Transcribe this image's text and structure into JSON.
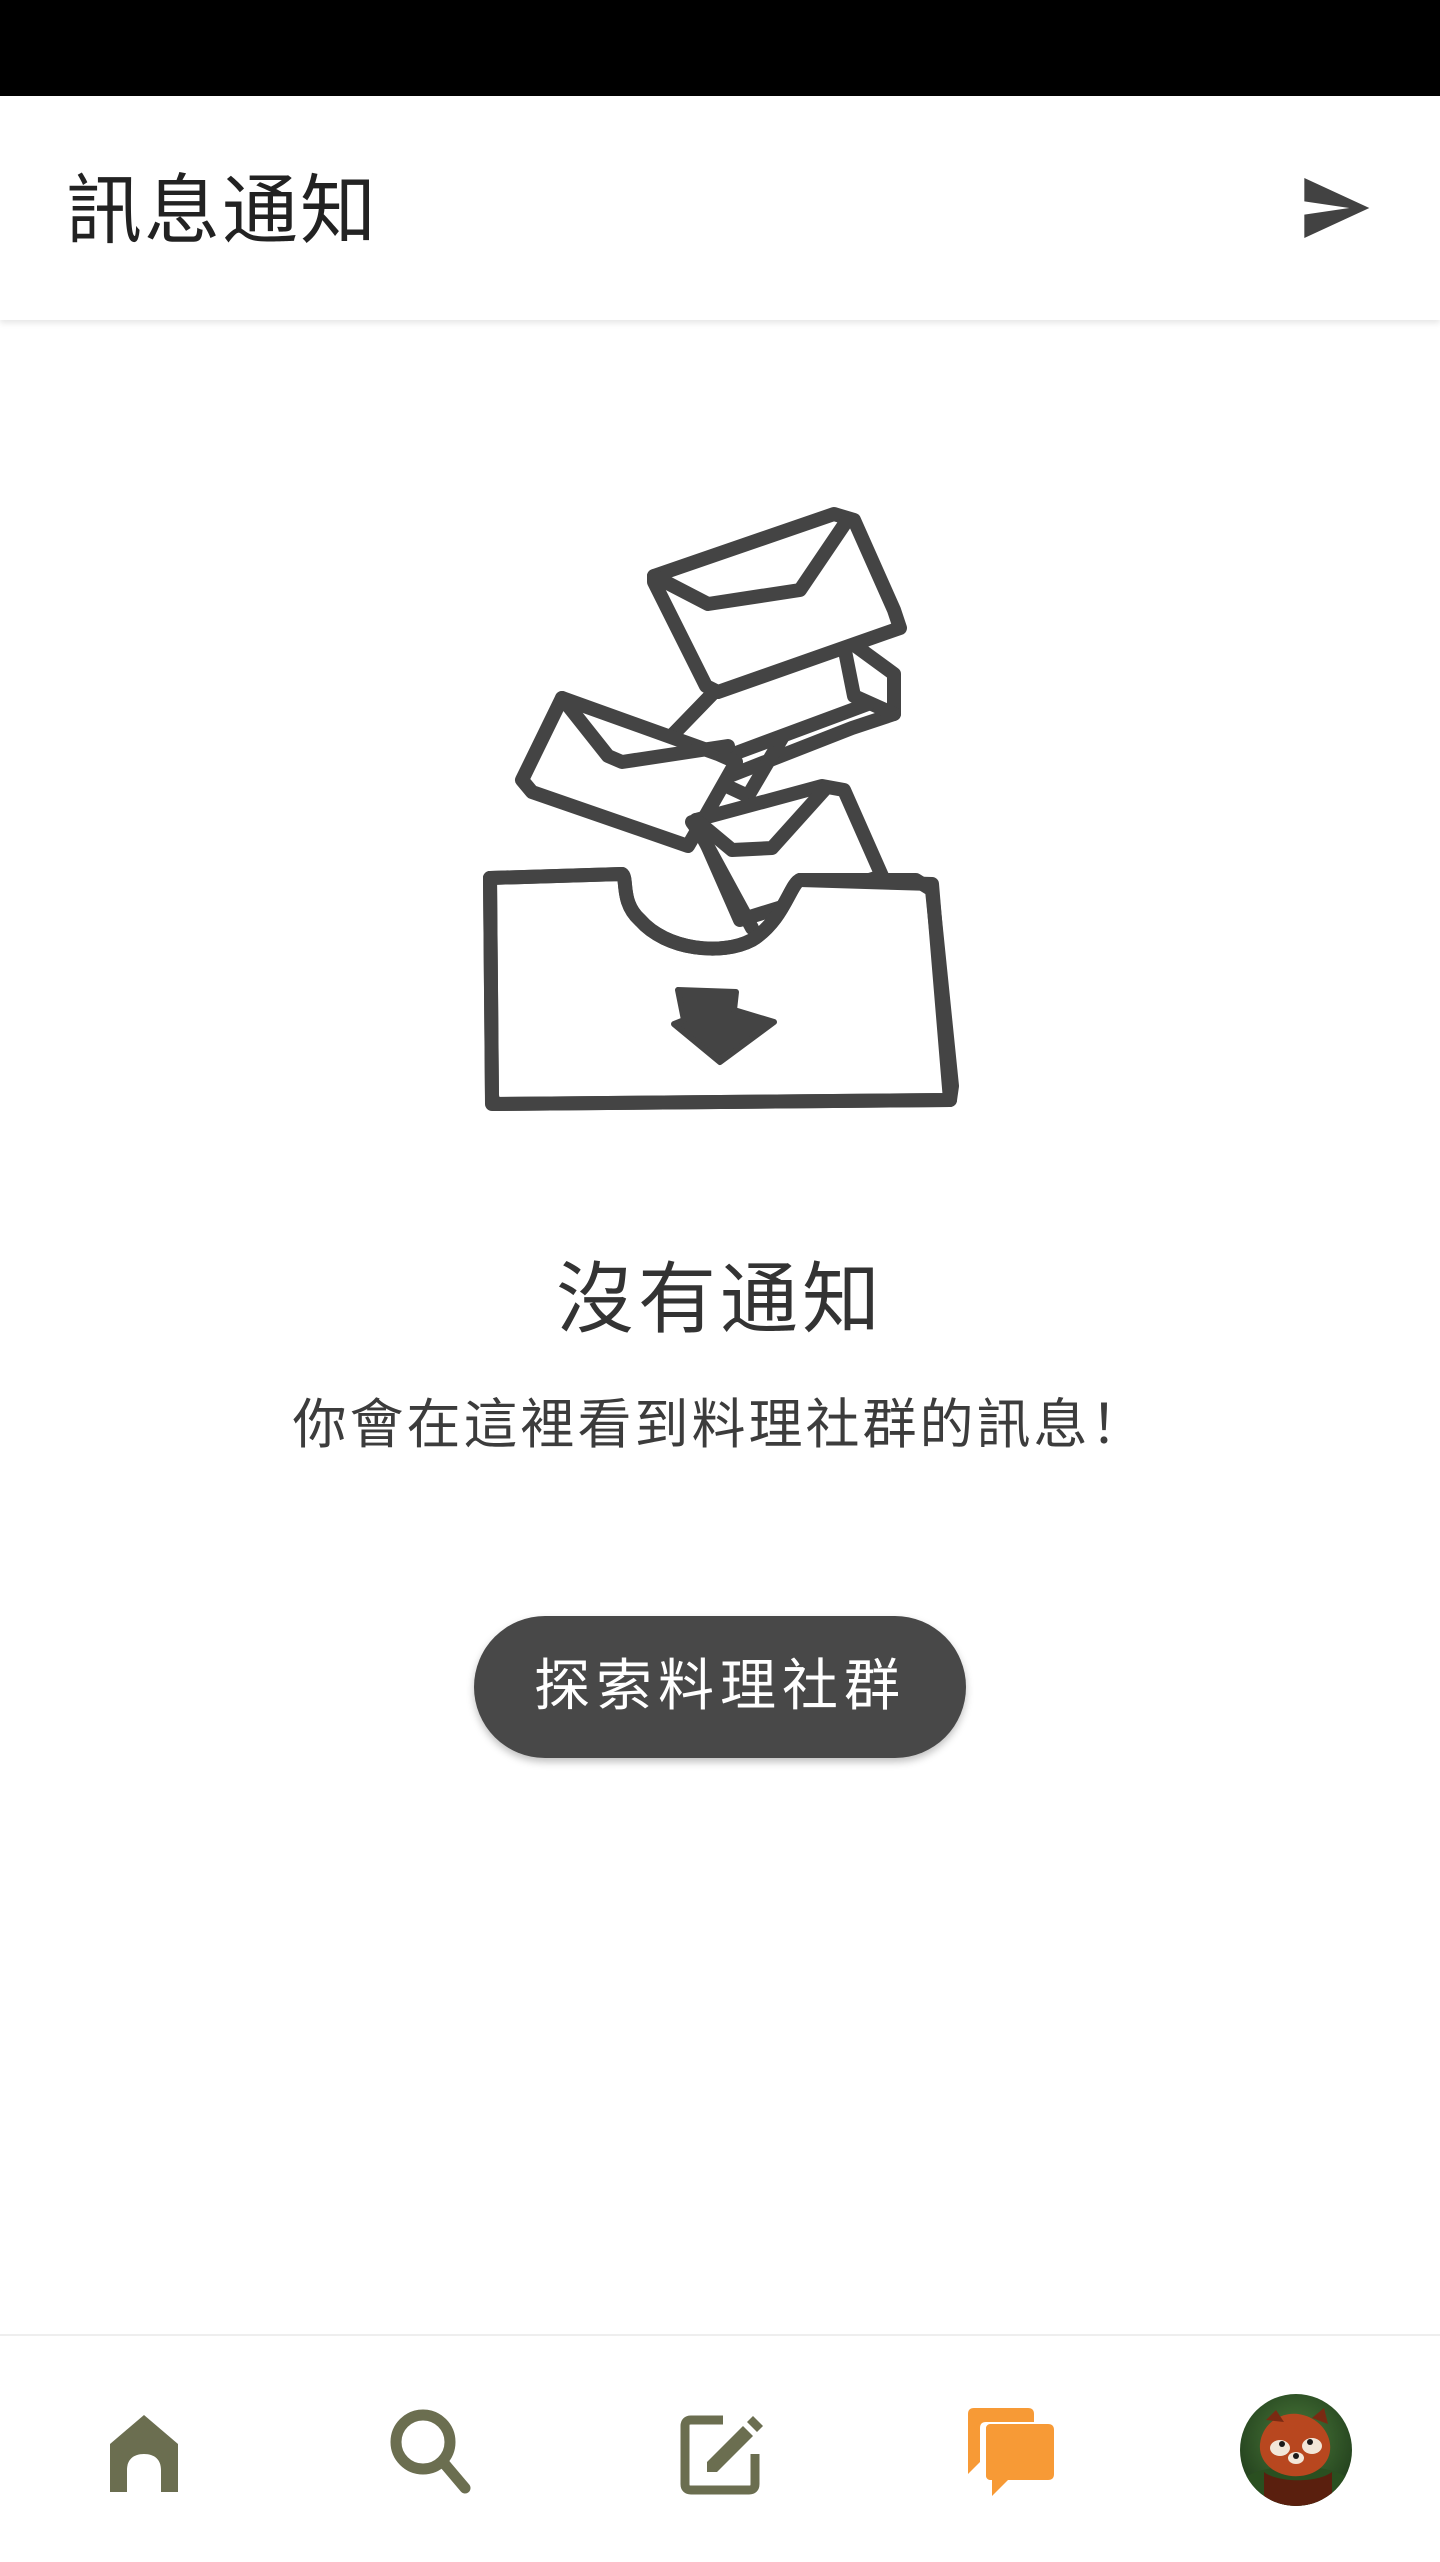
{
  "header": {
    "title": "訊息通知",
    "send_icon": "send-icon"
  },
  "empty_state": {
    "illustration": "inbox-envelopes-illustration",
    "title": "沒有通知",
    "subtitle": "你會在這裡看到料理社群的訊息！",
    "button_label": "探索料理社群"
  },
  "bottom_nav": {
    "items": [
      {
        "icon": "home-icon",
        "active": false
      },
      {
        "icon": "search-icon",
        "active": false
      },
      {
        "icon": "compose-icon",
        "active": false
      },
      {
        "icon": "messages-icon",
        "active": true
      },
      {
        "icon": "avatar-red-panda",
        "active": false
      }
    ],
    "inactive_color": "#6b6e50",
    "active_color": "#f79a36"
  },
  "colors": {
    "status_bar": "#000000",
    "button_bg": "#484848",
    "text_dark": "#222222"
  }
}
